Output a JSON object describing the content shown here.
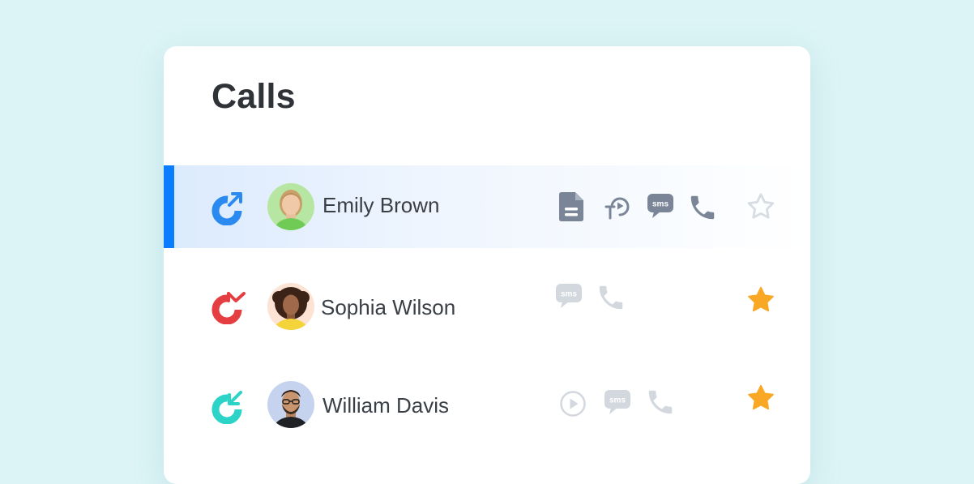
{
  "title": "Calls",
  "colors": {
    "background": "#dcf4f6",
    "accent": "#0a7cff",
    "outgoing": "#2a8af0",
    "missed": "#e53e42",
    "incoming": "#2bd4c6",
    "star_filled": "#f9a825",
    "icon_active": "#7a8698",
    "icon_muted": "#d3d8df"
  },
  "calls": [
    {
      "name": "Emily Brown",
      "direction_icon": "outgoing-call-icon",
      "selected": true,
      "actions": [
        "note-icon",
        "transcription-icon",
        "sms-icon",
        "phone-icon"
      ],
      "sms_label": "sms",
      "starred": false
    },
    {
      "name": "Sophia Wilson",
      "direction_icon": "missed-call-icon",
      "selected": false,
      "actions": [
        "sms-icon",
        "phone-icon"
      ],
      "sms_label": "sms",
      "starred": true
    },
    {
      "name": "William Davis",
      "direction_icon": "incoming-call-icon",
      "selected": false,
      "actions": [
        "play-icon",
        "sms-icon",
        "phone-icon"
      ],
      "sms_label": "sms",
      "starred": true
    }
  ]
}
